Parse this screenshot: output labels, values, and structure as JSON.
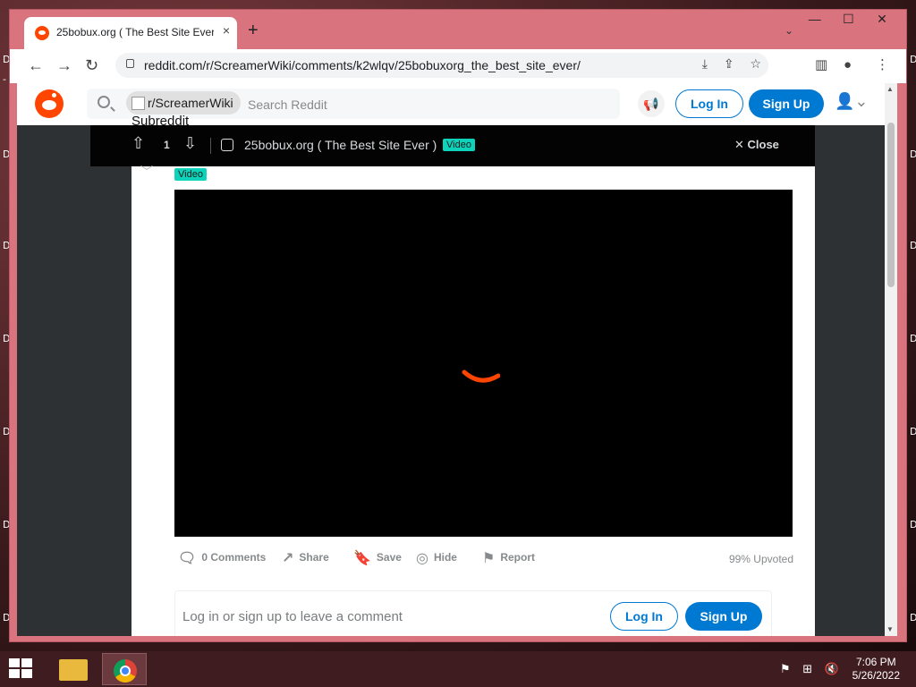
{
  "desktop": {
    "edge_marks": [
      "D",
      "-",
      "D",
      "-",
      "D",
      "-",
      "D",
      "-",
      "D",
      "-",
      "D",
      "-",
      "D",
      "-"
    ]
  },
  "browser": {
    "tab": {
      "title": "25bobux.org ( The Best Site Ever )",
      "close": "×"
    },
    "new_tab": "+",
    "window_controls": {
      "minimize": "—",
      "maximize": "☐",
      "close": "✕"
    },
    "tab_search": "⌄",
    "toolbar": {
      "back": "←",
      "forward": "→",
      "reload": "↻"
    },
    "url": "reddit.com/r/ScreamerWiki/comments/k2wlqv/25bobuxorg_the_best_site_ever/",
    "omnibox_icons": [
      "download-icon",
      "share-icon",
      "bookmark-star-icon"
    ],
    "right_icons": [
      "side-panel-icon",
      "profile-icon",
      "menu-icon"
    ]
  },
  "reddit": {
    "search": {
      "chip_label": "r/ScreamerWiki",
      "chip_sub": "Subreddit",
      "placeholder": "Search Reddit"
    },
    "header": {
      "login": "Log In",
      "signup": "Sign Up"
    },
    "overlay": {
      "score": "1",
      "title": "25bobux.org ( The Best Site Ever )",
      "flair": "Video",
      "close": "Close",
      "under_text": "Icon"
    },
    "post": {
      "flair": "Video",
      "actions": {
        "comments": "0 Comments",
        "share": "Share",
        "save": "Save",
        "hide": "Hide",
        "report": "Report"
      },
      "upvoted": "99% Upvoted"
    },
    "comment_box": {
      "prompt": "Log in or sign up to leave a comment",
      "login": "Log In",
      "signup": "Sign Up"
    }
  },
  "taskbar": {
    "clock_time": "7:06 PM",
    "clock_date": "5/26/2022"
  },
  "colors": {
    "reddit_orange": "#ff4500",
    "reddit_blue": "#0079d3",
    "flair_teal": "#0dd3bb"
  }
}
